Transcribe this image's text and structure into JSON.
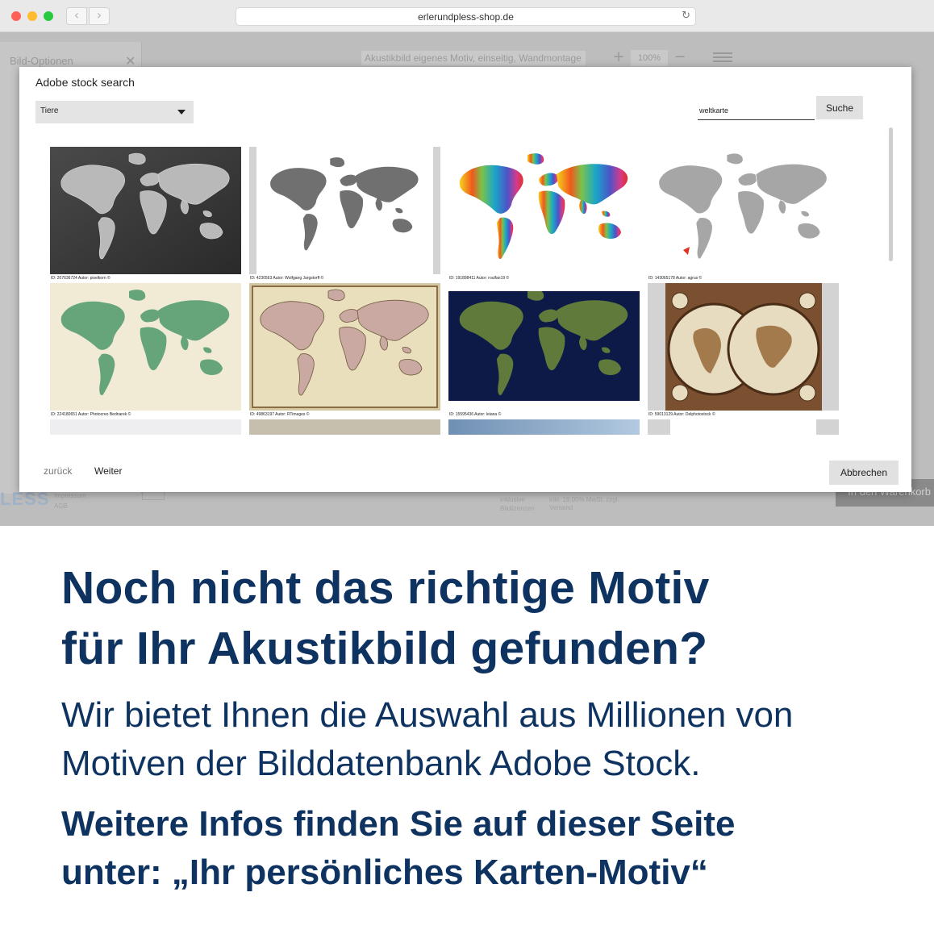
{
  "browser": {
    "url": "erlerundpless-shop.de",
    "back_icon": "chevron-left-icon",
    "forward_icon": "chevron-right-icon",
    "reload_icon": "reload-icon"
  },
  "background_page": {
    "panel_title": "Bild-Optionen",
    "product_title": "Akustikbild eigenes Motiv, einseitig, Wandmontage",
    "zoom": "100%",
    "logo": "LESS",
    "footer_left": [
      "Impressum",
      "AGB"
    ],
    "footer_mid": [
      "inklusive",
      "Bildlizenzen"
    ],
    "footer_right": [
      "inkl. 19,00% MwSt. zzgl.",
      "Versand"
    ],
    "cart_label": "In den Warenkorb"
  },
  "modal": {
    "title": "Adobe stock search",
    "category": "Tiere",
    "search_value": "weltkarte",
    "search_button": "Suche",
    "back_button": "zurück",
    "next_button": "Weiter",
    "cancel_button": "Abbrechen"
  },
  "results": [
    {
      "caption": "ID: 207636724 Autor: pixelkorn ©"
    },
    {
      "caption": "ID: 4230563 Autor: Wolfgang Jargstorff ©"
    },
    {
      "caption": "ID: 191898411 Autor: roulfan19 ©"
    },
    {
      "caption": "ID: 143065178 Autor: agrus ©"
    },
    {
      "caption": "ID: 224180651 Autor: Photocreo Bednarek ©"
    },
    {
      "caption": "ID: 49863197 Autor: RTimages ©"
    },
    {
      "caption": "ID: 15595436 Autor: leiana ©"
    },
    {
      "caption": "ID: 59013129 Autor: Delphotostock ©"
    }
  ],
  "promo": {
    "headline_1": "Noch nicht das richtige Motiv",
    "headline_2": "für Ihr Akustikbild gefunden?",
    "body_1": "Wir bietet Ihnen die Auswahl aus Millionen von",
    "body_2": "Motiven der Bilddatenbank Adobe Stock.",
    "info_1": "Weitere Infos finden Sie auf dieser Seite",
    "info_2": "unter: „Ihr persönliches Karten-Motiv“"
  },
  "colors": {
    "promo_text": "#0f3361",
    "dim_background": "#bdbdbd",
    "button_grey": "#e1e1e1"
  }
}
